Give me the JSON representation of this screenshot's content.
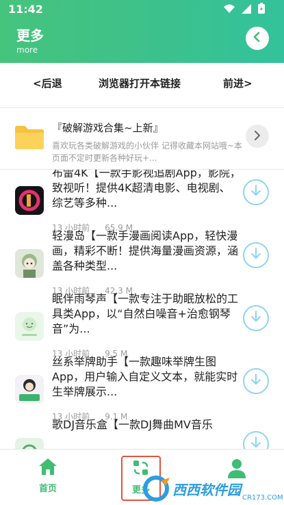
{
  "status_bar": {
    "time": "11:42"
  },
  "header": {
    "title": "更多",
    "subtitle": "more"
  },
  "navbar": {
    "back": "<后退",
    "open_in_browser": "浏览器打开本链接",
    "forward": "前进>"
  },
  "banner": {
    "title": "『破解游戏合集~上新』",
    "description": "喜欢玩各类破解游戏的小伙伴 记得收藏本网站哦~本页面不定时更新各种好玩+..."
  },
  "apps": [
    {
      "title": "布雷4K【一款手影视追剧App，影院，致视听！提供4K超清电影、电视剧、综艺等多种...",
      "time": "13 小时前",
      "size": "65.9 M",
      "icon": "bolei-4k-icon"
    },
    {
      "title": "轻漫岛【一款手漫画阅读App，轻快漫画，精彩不断！提供海量漫画资源，涵盖各种类型...",
      "time": "13 小时前",
      "size": "42.3 M",
      "icon": "qingmandao-icon"
    },
    {
      "title": "眠伴雨琴声【一款专注于助眠放松的工具类App，以“自然白噪音+治愈钢琴音”为...",
      "time": "13 小时前",
      "size": "9.5 M",
      "icon": "mianban-icon"
    },
    {
      "title": "丝系举牌助手【一款趣味举牌生图App，用户输入自定义文本，就能实时生举牌展示...",
      "time": "13 小时前",
      "size": "9.1 M",
      "icon": "juPai-icon"
    },
    {
      "title": "歌DJ音乐盒【一款DJ舞曲MV音乐",
      "time": "",
      "size": "",
      "icon": "dj-music-icon"
    }
  ],
  "bottom_nav": {
    "home": "首页",
    "more": "更多"
  },
  "watermark": {
    "text": "西西软件园",
    "sub": "CR173.COM"
  },
  "colors": {
    "accent": "#3ebd74",
    "download_ring": "#8fd3f0",
    "highlight_box": "#e0553b"
  }
}
